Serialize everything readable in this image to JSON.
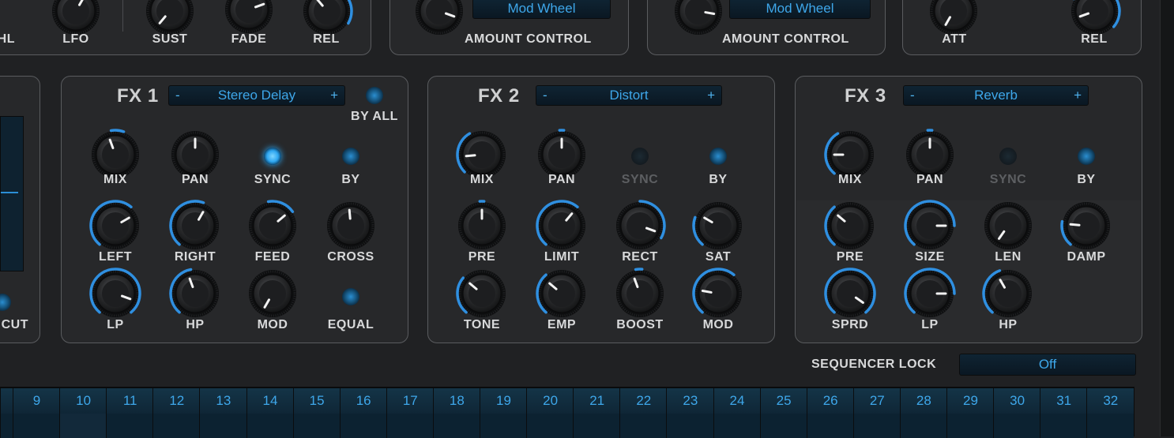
{
  "top": {
    "labels": [
      "WHL",
      "LFO",
      "SUST",
      "FADE",
      "REL",
      "AMOUNT CONTROL",
      "AMOUNT CONTROL",
      "ATT",
      "REL"
    ],
    "mod_wheel_1": "Mod Wheel",
    "mod_wheel_2": "Mod Wheel"
  },
  "left": {
    "cut_label": "CUT"
  },
  "fx1": {
    "title": "FX 1",
    "effect": "Stereo Delay",
    "minus": "-",
    "plus": "+",
    "bypass_all": "BY ALL",
    "labels": [
      "MIX",
      "PAN",
      "SYNC",
      "BY",
      "LEFT",
      "RIGHT",
      "FEED",
      "CROSS",
      "LP",
      "HP",
      "MOD",
      "EQUAL"
    ]
  },
  "fx2": {
    "title": "FX 2",
    "effect": "Distort",
    "minus": "-",
    "plus": "+",
    "labels": [
      "MIX",
      "PAN",
      "SYNC",
      "BY",
      "PRE",
      "LIMIT",
      "RECT",
      "SAT",
      "TONE",
      "EMP",
      "BOOST",
      "MOD"
    ]
  },
  "fx3": {
    "title": "FX 3",
    "effect": "Reverb",
    "minus": "-",
    "plus": "+",
    "labels": [
      "MIX",
      "PAN",
      "SYNC",
      "BY",
      "PRE",
      "SIZE",
      "LEN",
      "DAMP",
      "SPRD",
      "LP",
      "HP"
    ]
  },
  "sequencer": {
    "lock_label": "SEQUENCER LOCK",
    "lock_value": "Off",
    "steps": [
      "9",
      "10",
      "11",
      "12",
      "13",
      "14",
      "15",
      "16",
      "17",
      "18",
      "19",
      "20",
      "21",
      "22",
      "23",
      "24",
      "25",
      "26",
      "27",
      "28",
      "29",
      "30",
      "31",
      "32"
    ]
  },
  "colors": {
    "accent": "#2f8fe0",
    "panel_bg": "#27282a",
    "led_on": "#2ea6f0"
  }
}
